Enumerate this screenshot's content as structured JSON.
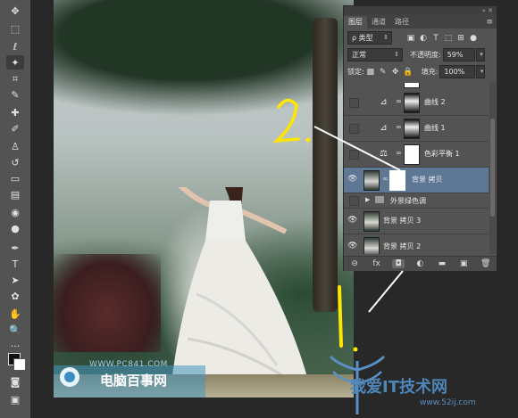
{
  "panel": {
    "tabs": [
      "图层",
      "通道",
      "路径"
    ],
    "filter_kind": "类型",
    "blend_mode": "正常",
    "opacity_label": "不透明度:",
    "opacity_value": "59%",
    "lock_label": "锁定:",
    "fill_label": "填充:",
    "fill_value": "100%",
    "layers": [
      {
        "name": "曲线 2",
        "type": "curves",
        "visible": false,
        "selected": false
      },
      {
        "name": "曲线 1",
        "type": "curves",
        "visible": false,
        "selected": false
      },
      {
        "name": "色彩平衡 1",
        "type": "color-balance",
        "visible": false,
        "selected": false
      },
      {
        "name": "背景 拷贝",
        "type": "pixel-with-mask",
        "visible": true,
        "selected": true
      },
      {
        "name": "外景绿色调",
        "type": "group",
        "visible": false,
        "selected": false
      },
      {
        "name": "背景 拷贝 3",
        "type": "pixel",
        "visible": true,
        "selected": false
      },
      {
        "name": "背景 拷贝 2",
        "type": "pixel",
        "visible": true,
        "selected": false
      }
    ]
  },
  "photo_watermark": {
    "url": "WWW.PC841.COM",
    "title": "电脑百事网"
  },
  "page_watermark": {
    "title": "我爱IT技术网",
    "url": "www.52ij.com"
  },
  "annotations": {
    "step1": "1.",
    "step2": "2."
  },
  "colors": {
    "panel_bg": "#535353",
    "selected_layer": "#5d7794",
    "annotation": "#ffe600",
    "arrow": "#ffffff"
  }
}
